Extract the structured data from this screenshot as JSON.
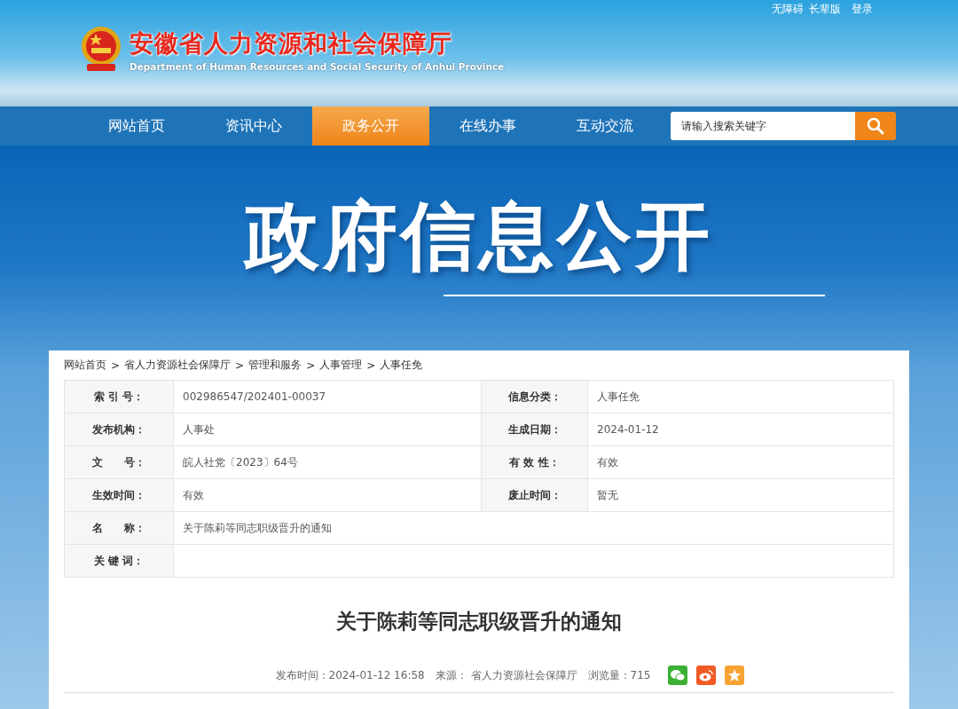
{
  "top_links": [
    "无障碍",
    "长辈版",
    "登录"
  ],
  "site": {
    "title": "安徽省人力资源和社会保障厅",
    "subtitle": "Department of Human Resources and Social Security of Anhui Province"
  },
  "nav": [
    {
      "label": "网站首页",
      "selected": false
    },
    {
      "label": "资讯中心",
      "selected": false
    },
    {
      "label": "政务公开",
      "selected": true
    },
    {
      "label": "在线办事",
      "selected": false
    },
    {
      "label": "互动交流",
      "selected": false
    }
  ],
  "search": {
    "placeholder": "请输入搜索关键字"
  },
  "banner_title": "政府信息公开",
  "breadcrumb_separator": ">",
  "breadcrumb": [
    "网站首页",
    "省人力资源社会保障厅",
    "管理和服务",
    "人事管理",
    "人事任免"
  ],
  "meta_rows": [
    [
      {
        "label": "索 引 号：",
        "value": "002986547/202401-00037"
      },
      {
        "label": "信息分类：",
        "value": "人事任免"
      }
    ],
    [
      {
        "label": "发布机构：",
        "value": "人事处"
      },
      {
        "label": "生成日期：",
        "value": "2024-01-12"
      }
    ],
    [
      {
        "label": "文　　号：",
        "value": "皖人社党〔2023〕64号"
      },
      {
        "label": "有 效 性：",
        "value": "有效"
      }
    ],
    [
      {
        "label": "生效时间：",
        "value": "有效"
      },
      {
        "label": "废止时间：",
        "value": "暂无"
      }
    ],
    [
      {
        "label": "名　　称：",
        "value": "关于陈莉等同志职级晋升的通知"
      }
    ],
    [
      {
        "label": "关 键 词："
      }
    ]
  ],
  "article": {
    "title": "关于陈莉等同志职级晋升的通知",
    "info": [
      "发布时间：2024-01-12 16:58",
      "来源： 省人力资源社会保障厅",
      "浏览量：715"
    ]
  }
}
